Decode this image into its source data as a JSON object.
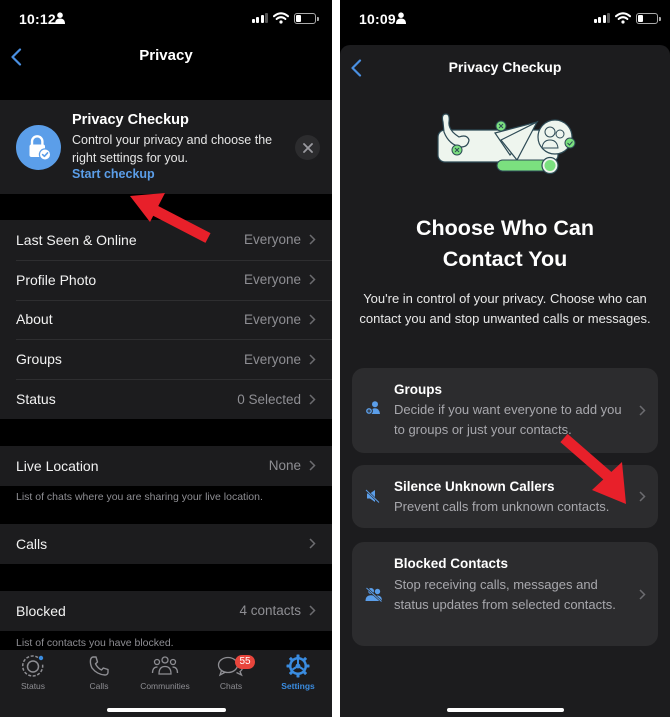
{
  "left_screen": {
    "status_bar": {
      "time": "10:12"
    },
    "nav": {
      "title": "Privacy"
    },
    "checkup_banner": {
      "title": "Privacy Checkup",
      "description": "Control your privacy and choose the right settings for you.",
      "link": "Start checkup",
      "icon": "lock-check-icon"
    },
    "privacy_rows": [
      {
        "label": "Last Seen & Online",
        "value": "Everyone"
      },
      {
        "label": "Profile Photo",
        "value": "Everyone"
      },
      {
        "label": "About",
        "value": "Everyone"
      },
      {
        "label": "Groups",
        "value": "Everyone"
      },
      {
        "label": "Status",
        "value": "0 Selected"
      }
    ],
    "live_location": {
      "label": "Live Location",
      "value": "None",
      "footnote": "List of chats where you are sharing your live location."
    },
    "calls": {
      "label": "Calls",
      "value": ""
    },
    "blocked": {
      "label": "Blocked",
      "value": "4 contacts",
      "footnote": "List of contacts you have blocked."
    },
    "tab_bar": {
      "tabs": [
        {
          "label": "Status",
          "icon": "status-icon"
        },
        {
          "label": "Calls",
          "icon": "phone-icon"
        },
        {
          "label": "Communities",
          "icon": "communities-icon"
        },
        {
          "label": "Chats",
          "icon": "chat-bubbles-icon",
          "badge": "55"
        },
        {
          "label": "Settings",
          "icon": "settings-gear-icon",
          "active": true
        }
      ]
    }
  },
  "right_screen": {
    "status_bar": {
      "time": "10:09"
    },
    "nav": {
      "title": "Privacy Checkup"
    },
    "hero": {
      "title_line1": "Choose Who Can",
      "title_line2": "Contact You",
      "description": "You're in control of your privacy. Choose who can contact you and stop unwanted calls or messages."
    },
    "cards": [
      {
        "title": "Groups",
        "description": "Decide if you want everyone to add you to groups or just your contacts.",
        "icon": "add-person-icon"
      },
      {
        "title": "Silence Unknown Callers",
        "description": "Prevent calls from unknown contacts.",
        "icon": "speaker-muted-icon"
      },
      {
        "title": "Blocked Contacts",
        "description": "Stop receiving calls, messages and status updates from selected contacts.",
        "icon": "blocked-people-icon"
      }
    ]
  },
  "colors": {
    "accent_blue": "#5b9ee9",
    "tab_active": "#3a8ce0",
    "badge_red": "#e8453c",
    "annotation_red": "#e8202a",
    "illustration_green": "#7be07f"
  }
}
